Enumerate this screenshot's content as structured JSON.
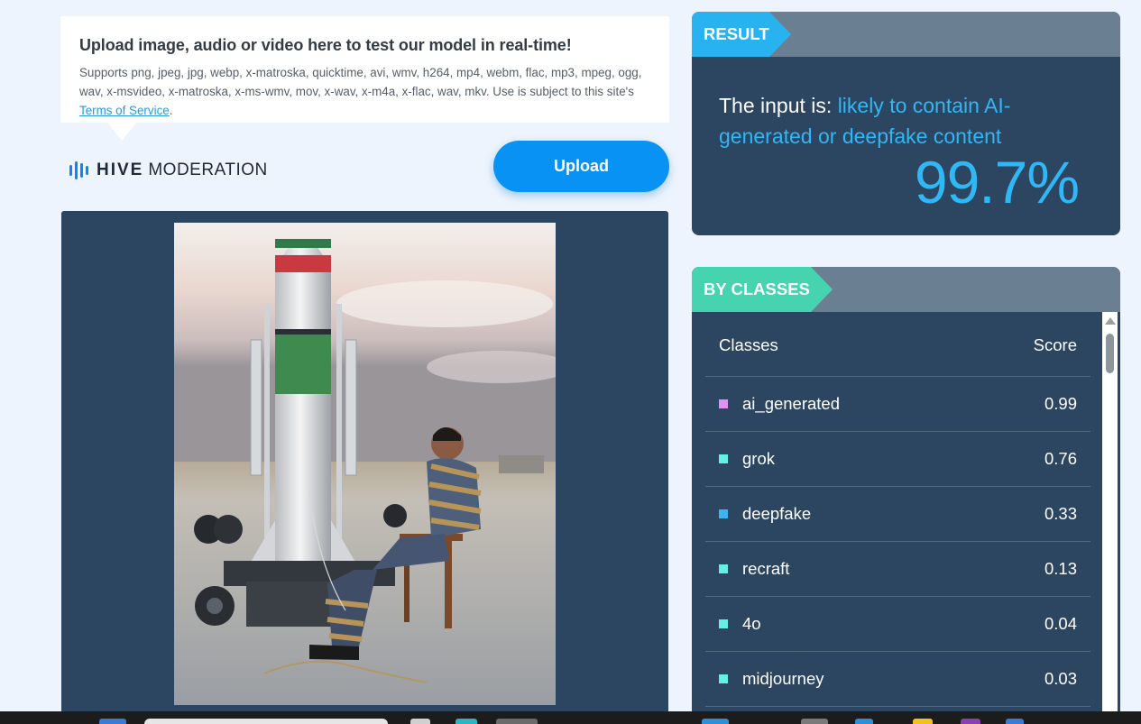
{
  "upload_info": {
    "title": "Upload image, audio or video here to test our model in real-time!",
    "description": "Supports png, jpeg, jpg, webp, x-matroska, quicktime, avi, wmv, h264, mp4, webm, flac, mp3, mpeg, ogg, wav, x-msvideo, x-matroska, x-ms-wmv, mov, x-wav, x-m4a, x-flac, wav, mkv. Use is subject to this site's ",
    "terms_link": "Terms of Service",
    "terms_suffix": "."
  },
  "logo": {
    "brand": "HIVE",
    "product": "MODERATION",
    "icon": "audio-bars-icon",
    "color": "#0a84ff"
  },
  "upload_button": {
    "label": "Upload"
  },
  "result": {
    "tag": "RESULT",
    "prefix": "The input is: ",
    "verdict": "likely to contain AI-generated or deepfake content",
    "score": "99.7%"
  },
  "classes": {
    "tag": "BY CLASSES",
    "header_class": "Classes",
    "header_score": "Score",
    "rows": [
      {
        "name": "ai_generated",
        "score": "0.99",
        "color": "#e291f0"
      },
      {
        "name": "grok",
        "score": "0.76",
        "color": "#64f0e6"
      },
      {
        "name": "deepfake",
        "score": "0.33",
        "color": "#3ab4f2"
      },
      {
        "name": "recraft",
        "score": "0.13",
        "color": "#64f0e6"
      },
      {
        "name": "4o",
        "score": "0.04",
        "color": "#64f0e6"
      },
      {
        "name": "midjourney",
        "score": "0.03",
        "color": "#64f0e6"
      }
    ]
  },
  "colors": {
    "accent": "#0893f4",
    "panel": "#2c4661",
    "highlight": "#2fb7f6",
    "result_tag": "#28b3f0",
    "classes_tag": "#46d3b0"
  }
}
